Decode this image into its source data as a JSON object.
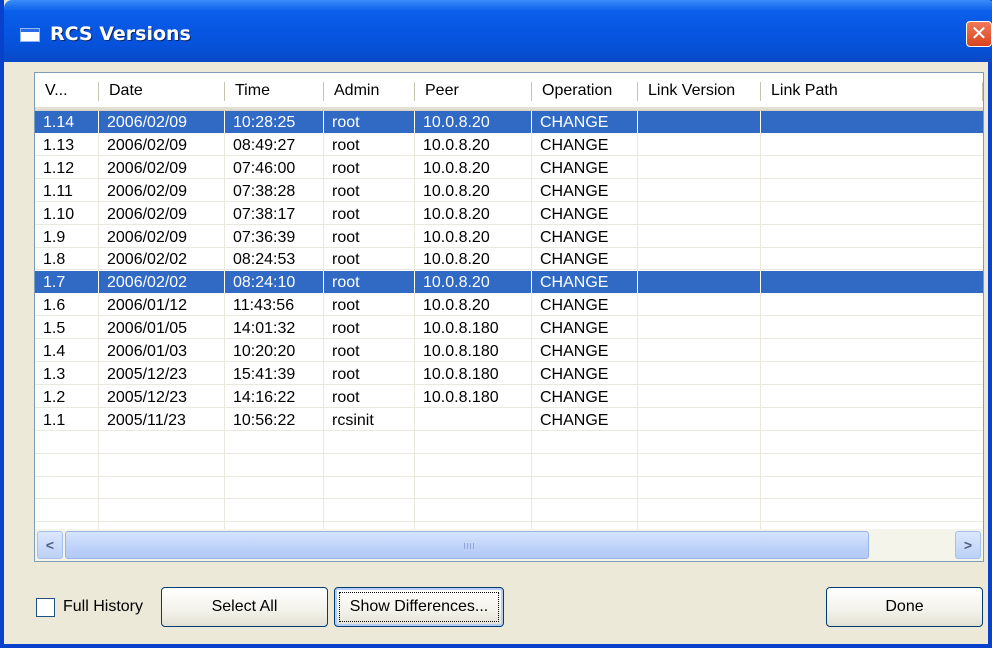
{
  "window": {
    "title": "RCS Versions",
    "close_glyph": "✕"
  },
  "list": {
    "columns": [
      "V...",
      "Date",
      "Time",
      "Admin",
      "Peer",
      "Operation",
      "Link Version",
      "Link Path"
    ],
    "rows": [
      {
        "version": "1.14",
        "date": "2006/02/09",
        "time": "10:28:25",
        "admin": "root",
        "peer": "10.0.8.20",
        "operation": "CHANGE",
        "link_version": "",
        "link_path": "",
        "selected": true
      },
      {
        "version": "1.13",
        "date": "2006/02/09",
        "time": "08:49:27",
        "admin": "root",
        "peer": "10.0.8.20",
        "operation": "CHANGE",
        "link_version": "",
        "link_path": "",
        "selected": false
      },
      {
        "version": "1.12",
        "date": "2006/02/09",
        "time": "07:46:00",
        "admin": "root",
        "peer": "10.0.8.20",
        "operation": "CHANGE",
        "link_version": "",
        "link_path": "",
        "selected": false
      },
      {
        "version": "1.11",
        "date": "2006/02/09",
        "time": "07:38:28",
        "admin": "root",
        "peer": "10.0.8.20",
        "operation": "CHANGE",
        "link_version": "",
        "link_path": "",
        "selected": false
      },
      {
        "version": "1.10",
        "date": "2006/02/09",
        "time": "07:38:17",
        "admin": "root",
        "peer": "10.0.8.20",
        "operation": "CHANGE",
        "link_version": "",
        "link_path": "",
        "selected": false
      },
      {
        "version": "1.9",
        "date": "2006/02/09",
        "time": "07:36:39",
        "admin": "root",
        "peer": "10.0.8.20",
        "operation": "CHANGE",
        "link_version": "",
        "link_path": "",
        "selected": false
      },
      {
        "version": "1.8",
        "date": "2006/02/02",
        "time": "08:24:53",
        "admin": "root",
        "peer": "10.0.8.20",
        "operation": "CHANGE",
        "link_version": "",
        "link_path": "",
        "selected": false
      },
      {
        "version": "1.7",
        "date": "2006/02/02",
        "time": "08:24:10",
        "admin": "root",
        "peer": "10.0.8.20",
        "operation": "CHANGE",
        "link_version": "",
        "link_path": "",
        "selected": true
      },
      {
        "version": "1.6",
        "date": "2006/01/12",
        "time": "11:43:56",
        "admin": "root",
        "peer": "10.0.8.20",
        "operation": "CHANGE",
        "link_version": "",
        "link_path": "",
        "selected": false
      },
      {
        "version": "1.5",
        "date": "2006/01/05",
        "time": "14:01:32",
        "admin": "root",
        "peer": "10.0.8.180",
        "operation": "CHANGE",
        "link_version": "",
        "link_path": "",
        "selected": false
      },
      {
        "version": "1.4",
        "date": "2006/01/03",
        "time": "10:20:20",
        "admin": "root",
        "peer": "10.0.8.180",
        "operation": "CHANGE",
        "link_version": "",
        "link_path": "",
        "selected": false
      },
      {
        "version": "1.3",
        "date": "2005/12/23",
        "time": "15:41:39",
        "admin": "root",
        "peer": "10.0.8.180",
        "operation": "CHANGE",
        "link_version": "",
        "link_path": "",
        "selected": false
      },
      {
        "version": "1.2",
        "date": "2005/12/23",
        "time": "14:16:22",
        "admin": "root",
        "peer": "10.0.8.180",
        "operation": "CHANGE",
        "link_version": "",
        "link_path": "",
        "selected": false
      },
      {
        "version": "1.1",
        "date": "2005/11/23",
        "time": "10:56:22",
        "admin": "rcsinit",
        "peer": "",
        "operation": "CHANGE",
        "link_version": "",
        "link_path": "",
        "selected": false
      }
    ]
  },
  "scrollbar": {
    "left_glyph": "<",
    "right_glyph": ">"
  },
  "controls": {
    "full_history_label": "Full History",
    "full_history_checked": false,
    "select_all_label": "Select All",
    "show_differences_label": "Show Differences...",
    "done_label": "Done"
  },
  "colors": {
    "selection": "#316ac5",
    "titlebar": "#0a5fea",
    "face": "#ece9d8"
  }
}
